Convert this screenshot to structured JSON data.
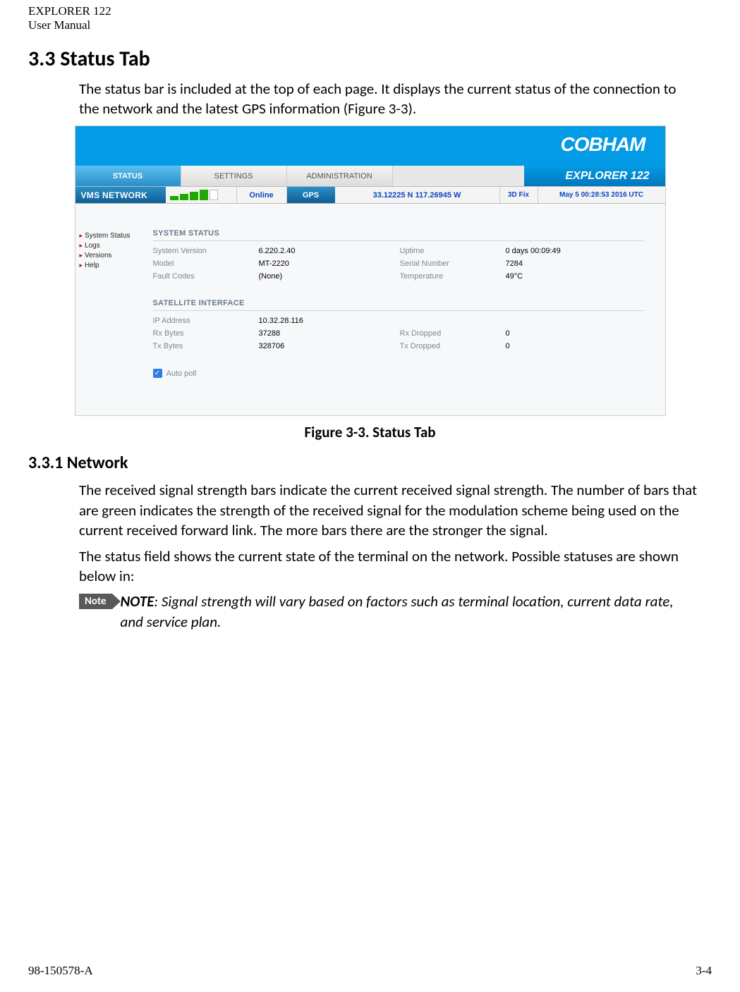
{
  "doc": {
    "header_line1": "EXPLORER 122",
    "header_line2": "User Manual",
    "footer_left": "98-150578-A",
    "footer_right": "3-4"
  },
  "section": {
    "h2": "3.3  Status Tab",
    "p1": "The status bar is included at the top of each page. It displays the current status of the connection to the network and the latest GPS information (Figure 3-3).",
    "fig_caption": "Figure 3-3. Status Tab",
    "h3": "3.3.1 Network",
    "p2": "The received signal strength bars indicate the current received signal strength. The number of bars that are green indicates the strength of the received signal for the modulation scheme being used on the current received forward link.  The more bars there are the stronger the signal.",
    "p3": "The status field shows the current state of the terminal on the network. Possible statuses are shown below in:",
    "note_label": "Note",
    "note_bold": "NOTE",
    "note_rest": ": Signal strength will vary based on factors such as terminal location, current data rate, and service plan."
  },
  "screenshot": {
    "brand": "COBHAM",
    "product": "EXPLORER 122",
    "tabs": {
      "status": "STATUS",
      "settings": "SETTINGS",
      "admin": "ADMINISTRATION"
    },
    "statusbar": {
      "network_label": "VMS NETWORK",
      "online": "Online",
      "gps_label": "GPS",
      "coords": "33.12225 N 117.26945 W",
      "fix": "3D Fix",
      "timestamp": "May 5 00:28:53 2016 UTC"
    },
    "sidenav": {
      "item1": "System Status",
      "item2": "Logs",
      "item3": "Versions",
      "item4": "Help"
    },
    "system_status": {
      "title": "SYSTEM STATUS",
      "k_version": "System Version",
      "v_version": "6.220.2.40",
      "k_uptime": "Uptime",
      "v_uptime": "0 days 00:09:49",
      "k_model": "Model",
      "v_model": "MT-2220",
      "k_serial": "Serial Number",
      "v_serial": "7284",
      "k_fault": "Fault Codes",
      "v_fault": "(None)",
      "k_temp": "Temperature",
      "v_temp": "49°C"
    },
    "sat_if": {
      "title": "SATELLITE INTERFACE",
      "k_ip": "IP Address",
      "v_ip": "10.32.28.116",
      "k_rx": "Rx Bytes",
      "v_rx": "37288",
      "k_rxd": "Rx Dropped",
      "v_rxd": "0",
      "k_tx": "Tx Bytes",
      "v_tx": "328706",
      "k_txd": "Tx Dropped",
      "v_txd": "0"
    },
    "autopoll": "Auto poll"
  }
}
